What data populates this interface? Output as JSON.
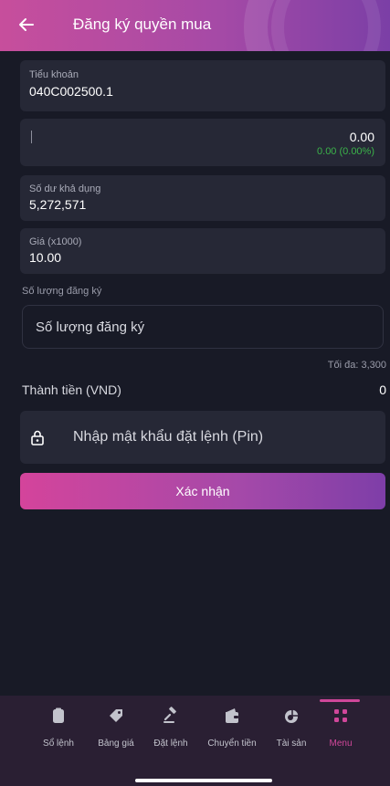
{
  "header": {
    "title": "Đăng ký quyền mua",
    "back_icon": "arrow-left-icon"
  },
  "form": {
    "sub_account": {
      "label": "Tiểu khoản",
      "value": "040C002500.1"
    },
    "stock": {
      "input_text": "",
      "price": "0.00",
      "change": "0.00 (0.00%)"
    },
    "available_balance": {
      "label": "Số dư khả dụng",
      "value": "5,272,571"
    },
    "price": {
      "label": "Giá (x1000)",
      "value": "10.00"
    },
    "quantity": {
      "caption": "Số lượng đăng ký",
      "placeholder": "Số lượng đăng ký",
      "max_text": "Tối đa: 3,300"
    },
    "total": {
      "label": "Thành tiền (VND)",
      "value": "0"
    },
    "pin": {
      "placeholder": "Nhập mật khẩu đặt lệnh (Pin)",
      "icon": "lock-icon"
    },
    "confirm_label": "Xác nhận"
  },
  "bottom_nav": {
    "items": [
      {
        "label": "Sổ lệnh",
        "icon": "clipboard-icon"
      },
      {
        "label": "Bảng giá",
        "icon": "price-tag-icon"
      },
      {
        "label": "Đặt lệnh",
        "icon": "gavel-icon"
      },
      {
        "label": "Chuyển tiền",
        "icon": "wallet-icon"
      },
      {
        "label": "Tài sản",
        "icon": "pie-chart-icon"
      },
      {
        "label": "Menu",
        "icon": "menu-dots-icon",
        "active": true
      }
    ]
  },
  "colors": {
    "background": "#181a26",
    "card": "#262836",
    "accent": "#d0479a",
    "positive": "#3bb34a",
    "header_gradient_start": "#c74e9c",
    "header_gradient_end": "#7b3fa6"
  }
}
